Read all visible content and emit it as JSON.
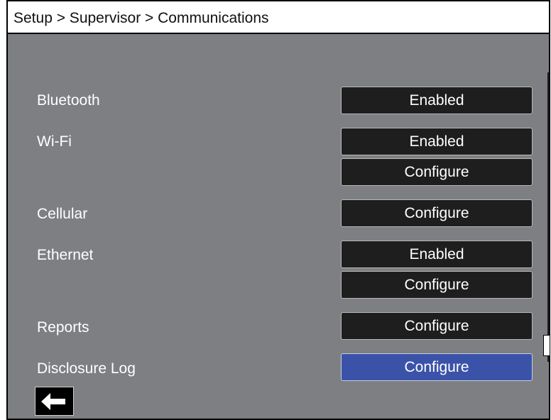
{
  "header": {
    "breadcrumb": "Setup > Supervisor > Communications"
  },
  "rows": {
    "bluetooth": {
      "label": "Bluetooth",
      "status": "Enabled"
    },
    "wifi": {
      "label": "Wi-Fi",
      "status": "Enabled",
      "configure": "Configure"
    },
    "cellular": {
      "label": "Cellular",
      "configure": "Configure"
    },
    "ethernet": {
      "label": "Ethernet",
      "status": "Enabled",
      "configure": "Configure"
    },
    "reports": {
      "label": "Reports",
      "configure": "Configure"
    },
    "disclosure_log": {
      "label": "Disclosure Log",
      "configure": "Configure",
      "selected": true
    }
  },
  "footer": {
    "back_icon": "arrow-left-icon"
  },
  "colors": {
    "panel_background": "#7d7f82",
    "button_background": "#1e1e1f",
    "selected_button": "#3a52a8",
    "title_background": "#ffffff"
  }
}
